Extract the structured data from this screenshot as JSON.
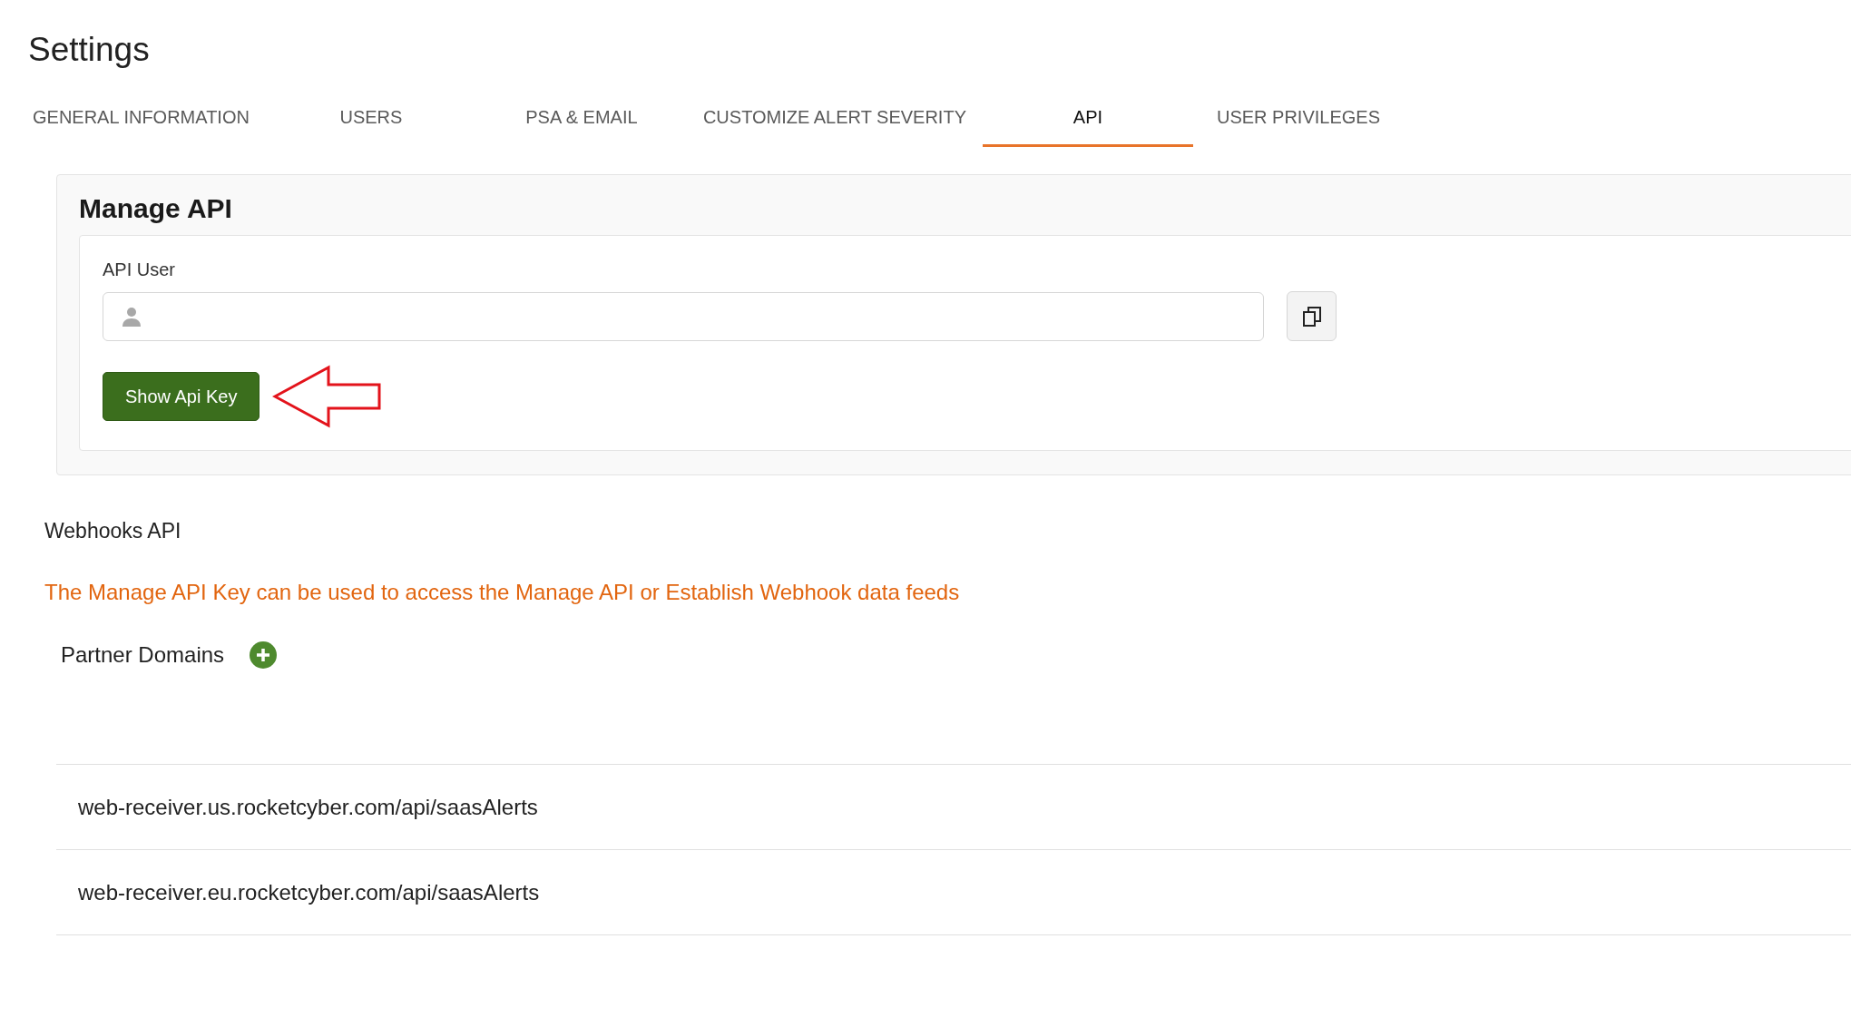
{
  "page_title": "Settings",
  "tabs": [
    {
      "label": "GENERAL INFORMATION",
      "selected": false
    },
    {
      "label": "USERS",
      "selected": false
    },
    {
      "label": "PSA & EMAIL",
      "selected": false
    },
    {
      "label": "CUSTOMIZE ALERT SEVERITY",
      "selected": false
    },
    {
      "label": "API",
      "selected": true
    },
    {
      "label": "USER PRIVILEGES",
      "selected": false
    }
  ],
  "manage_api": {
    "title": "Manage API",
    "field_label": "API User",
    "button": "Show Api Key"
  },
  "webhooks_title": "Webhooks API",
  "notice": "The Manage API Key can be used to access the Manage API or Establish Webhook data feeds",
  "partner_domains": {
    "label": "Partner Domains",
    "rows": [
      "web-receiver.us.rocketcyber.com/api/saasAlerts",
      "web-receiver.eu.rocketcyber.com/api/saasAlerts"
    ]
  }
}
